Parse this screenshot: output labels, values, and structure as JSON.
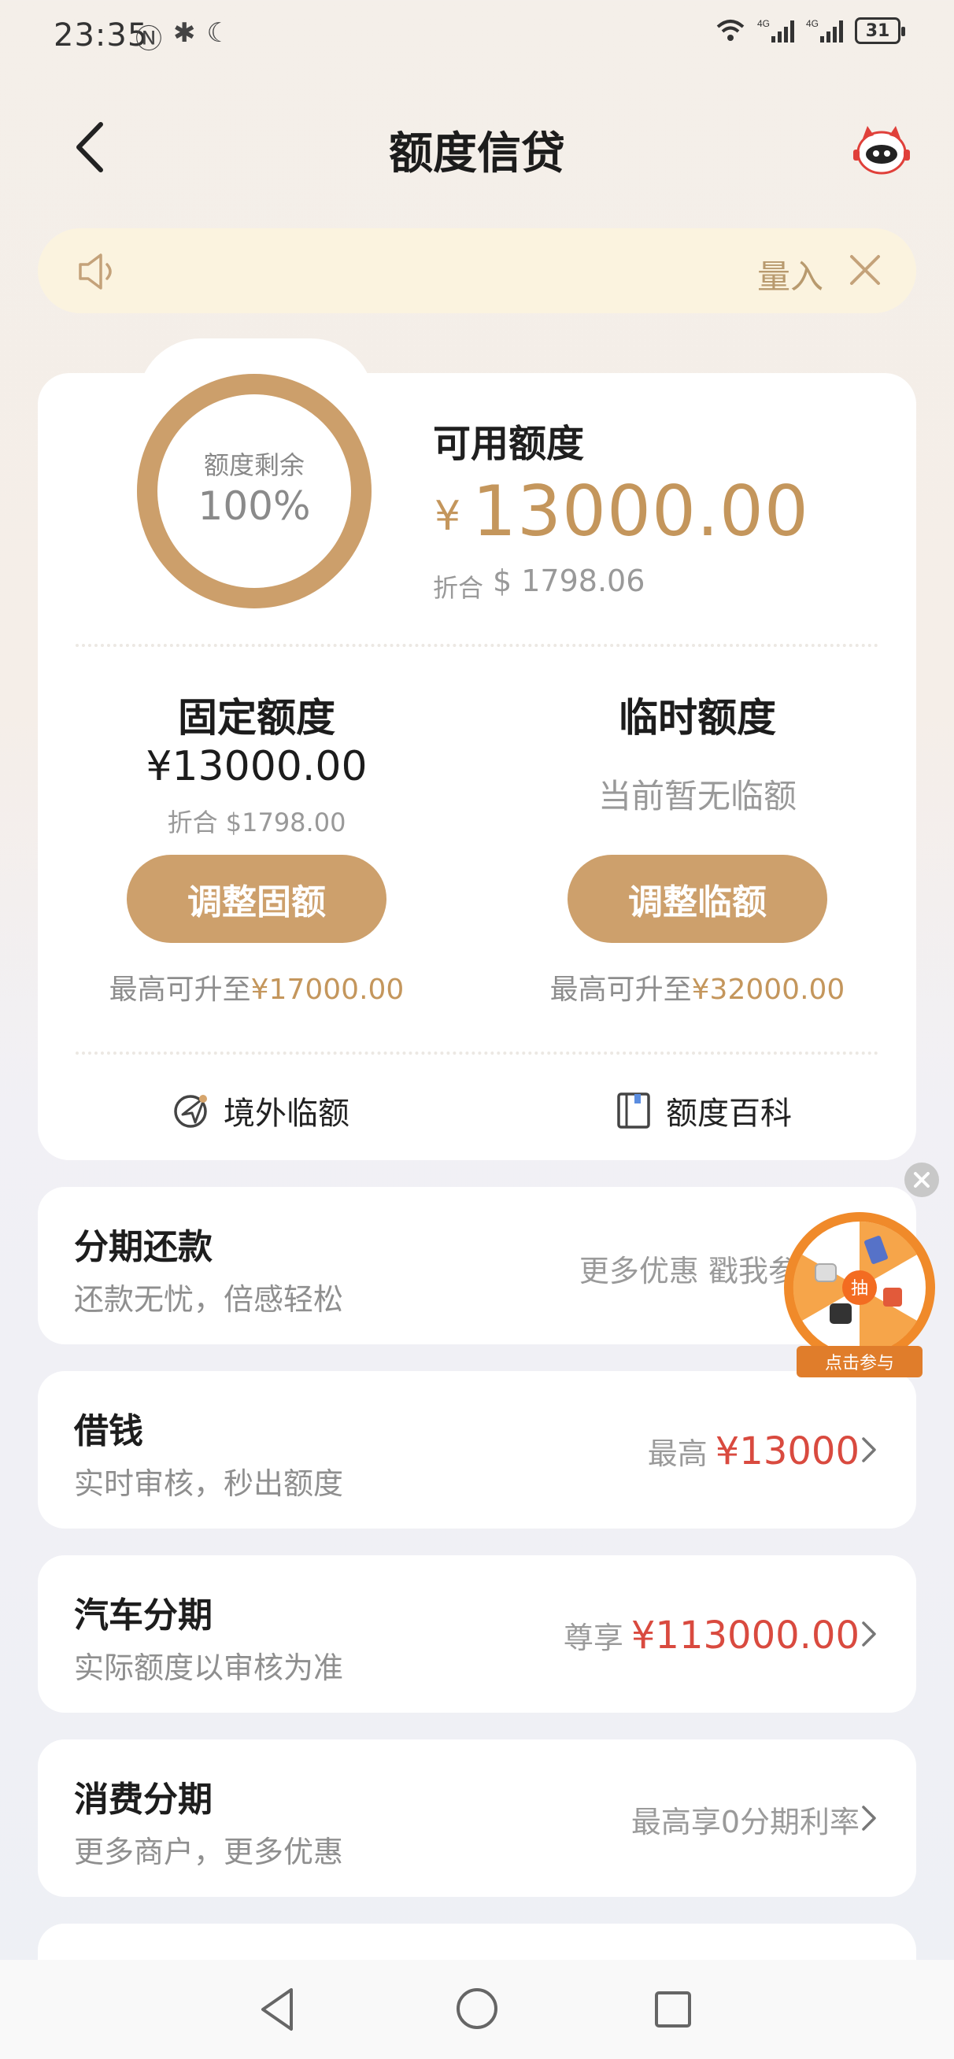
{
  "status_bar": {
    "time": "23:35",
    "icons": [
      "nfc-icon",
      "bluetooth-icon",
      "moon-icon",
      "wifi-icon",
      "signal-4g-icon",
      "signal-4g-icon"
    ],
    "battery": "31"
  },
  "header": {
    "title": "额度信贷"
  },
  "notice": {
    "text": "量入"
  },
  "credit": {
    "ring_label": "额度剩余",
    "ring_percent": "100%",
    "ring_fraction": 1.0,
    "available_title": "可用额度",
    "available_currency": "¥",
    "available_amount": "13000.00",
    "conv_label": "折合",
    "conv_value": "$ 1798.06",
    "fixed": {
      "title": "固定额度",
      "amount": "¥13000.00",
      "conv": "折合 $1798.00",
      "button": "调整固额",
      "max_prefix": "最高可升至",
      "max_value": "¥17000.00"
    },
    "temp": {
      "title": "临时额度",
      "empty": "当前暂无临额",
      "button": "调整临额",
      "max_prefix": "最高可升至",
      "max_value": "¥32000.00"
    },
    "links": {
      "overseas": "境外临额",
      "wiki": "额度百科"
    }
  },
  "list": [
    {
      "title": "分期还款",
      "sub": "还款无忧，倍感轻松",
      "right_prefix": "更多优惠 戳我参",
      "right_value": ""
    },
    {
      "title": "借钱",
      "sub": "实时审核，秒出额度",
      "right_prefix": "最高",
      "right_value": "¥13000"
    },
    {
      "title": "汽车分期",
      "sub": "实际额度以审核为准",
      "right_prefix": "尊享",
      "right_value": "¥113000.00"
    },
    {
      "title": "消费分期",
      "sub": "更多商户，更多优惠",
      "right_prefix": "最高享0分期利率",
      "right_value": ""
    }
  ],
  "wheel": {
    "center": "抽",
    "label": "点击参与"
  },
  "colors": {
    "gold": "#c4965c",
    "button_gold": "#cda06c",
    "red": "#d94a3f",
    "notice_bg": "#fbf3df"
  }
}
